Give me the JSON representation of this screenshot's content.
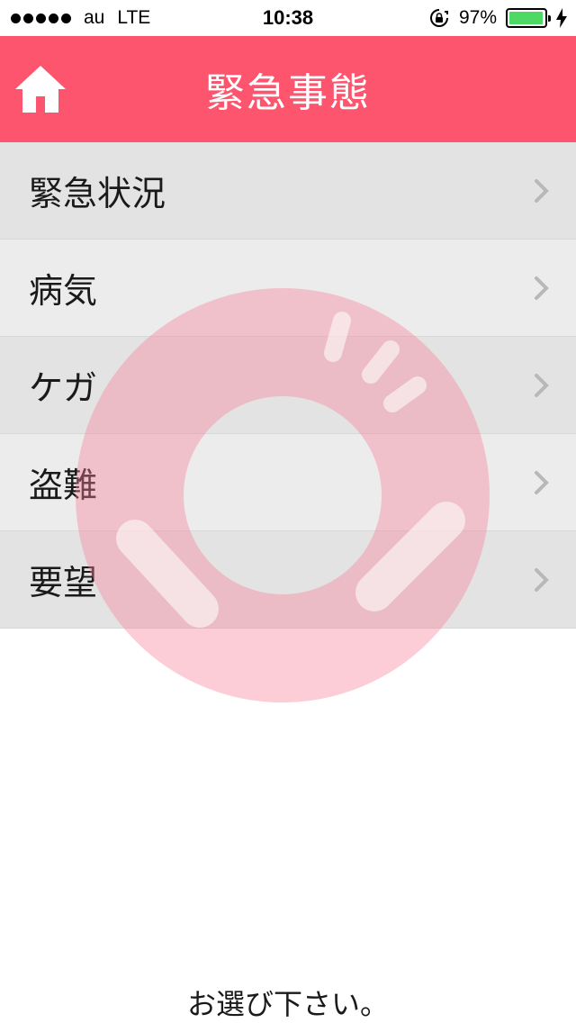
{
  "status_bar": {
    "carrier": "au",
    "network": "LTE",
    "time": "10:38",
    "battery_percent": "97%",
    "battery_level": 0.97,
    "icons": [
      "signal-dots-icon",
      "rotation-lock-icon",
      "battery-icon",
      "charging-bolt-icon"
    ]
  },
  "nav": {
    "title": "緊急事態",
    "home_icon": "home-icon",
    "color": "#fe556f"
  },
  "menu": {
    "items": [
      {
        "label": "緊急状況"
      },
      {
        "label": "病気"
      },
      {
        "label": "ケガ"
      },
      {
        "label": "盗難"
      },
      {
        "label": "要望"
      }
    ],
    "chevron_icon": "chevron-right-icon"
  },
  "watermark_icon": "lifebuoy-icon",
  "footer": {
    "text": "お選び下さい。"
  }
}
